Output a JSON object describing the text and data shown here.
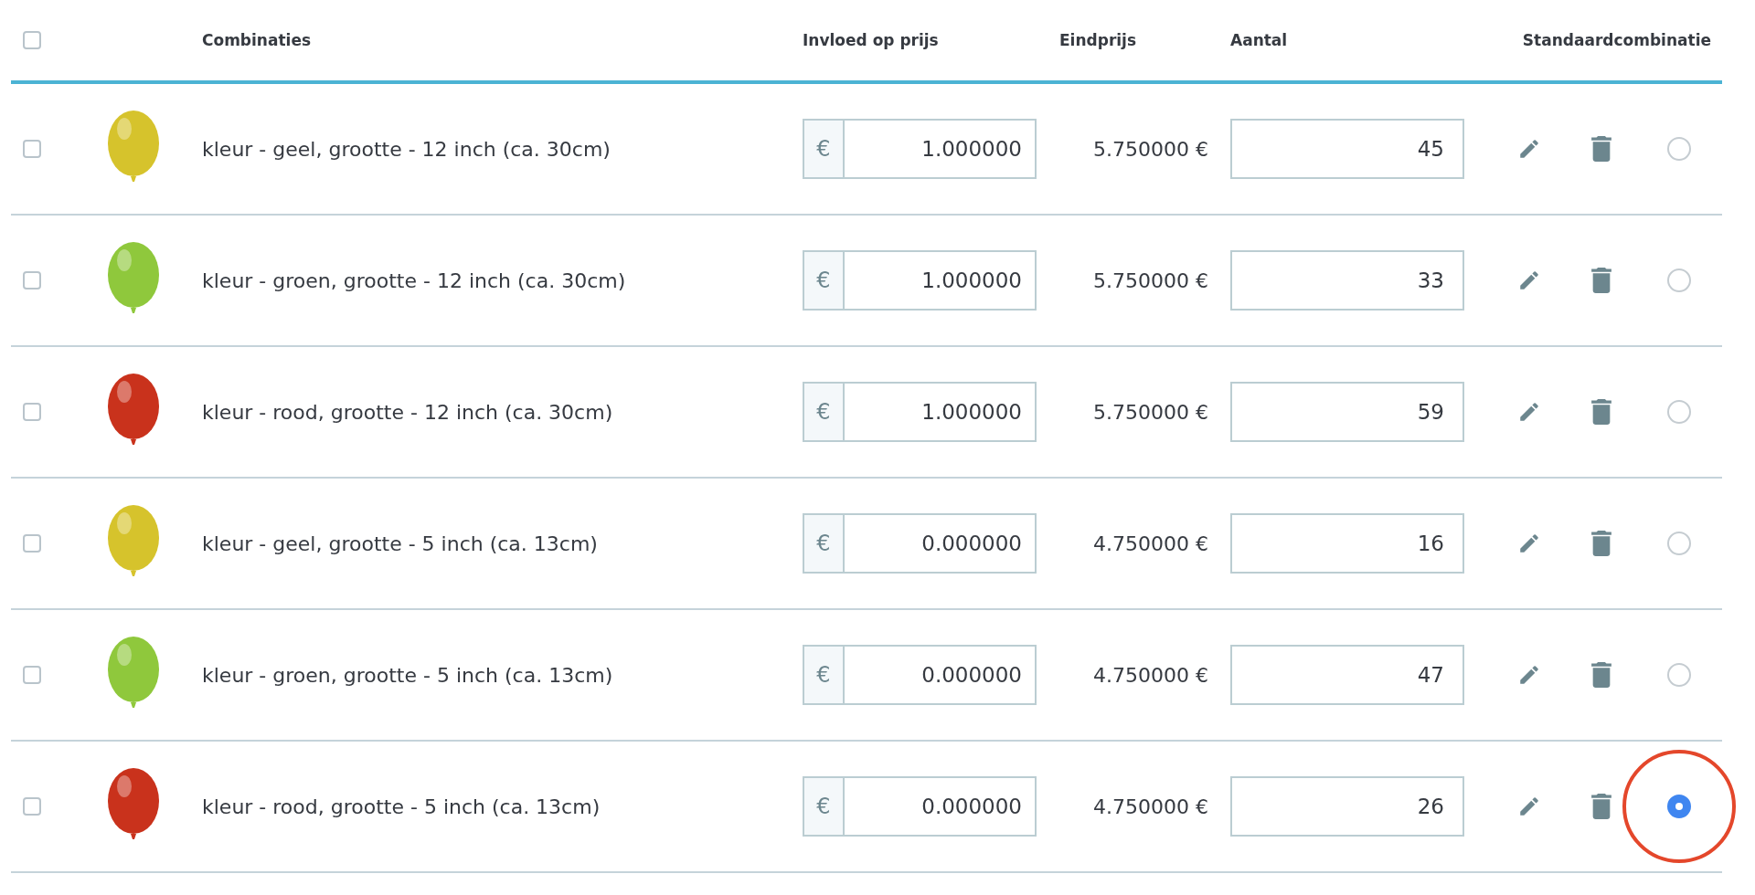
{
  "header": {
    "select_all_checked": false,
    "columns": [
      "Combinaties",
      "Invloed op prijs",
      "Eindprijs",
      "Aantal",
      "Standaardcombinatie"
    ]
  },
  "rows": [
    {
      "checked": false,
      "color": "#d6c32c",
      "name": "kleur - geel, grootte - 12 inch (ca. 30cm)",
      "currency": "€",
      "impact": "1.000000",
      "final_price": "5.750000 €",
      "quantity": "45",
      "selected": false,
      "circled": false
    },
    {
      "checked": false,
      "color": "#8fc83c",
      "name": "kleur - groen, grootte - 12 inch (ca. 30cm)",
      "currency": "€",
      "impact": "1.000000",
      "final_price": "5.750000 €",
      "quantity": "33",
      "selected": false,
      "circled": false
    },
    {
      "checked": false,
      "color": "#c9321c",
      "name": "kleur - rood, grootte - 12 inch (ca. 30cm)",
      "currency": "€",
      "impact": "1.000000",
      "final_price": "5.750000 €",
      "quantity": "59",
      "selected": false,
      "circled": false
    },
    {
      "checked": false,
      "color": "#d6c32c",
      "name": "kleur - geel, grootte - 5 inch (ca. 13cm)",
      "currency": "€",
      "impact": "0.000000",
      "final_price": "4.750000 €",
      "quantity": "16",
      "selected": false,
      "circled": false
    },
    {
      "checked": false,
      "color": "#8fc83c",
      "name": "kleur - groen, grootte - 5 inch (ca. 13cm)",
      "currency": "€",
      "impact": "0.000000",
      "final_price": "4.750000 €",
      "quantity": "47",
      "selected": false,
      "circled": false
    },
    {
      "checked": false,
      "color": "#c9321c",
      "name": "kleur - rood, grootte - 5 inch (ca. 13cm)",
      "currency": "€",
      "impact": "0.000000",
      "final_price": "4.750000 €",
      "quantity": "26",
      "selected": true,
      "circled": true
    }
  ]
}
